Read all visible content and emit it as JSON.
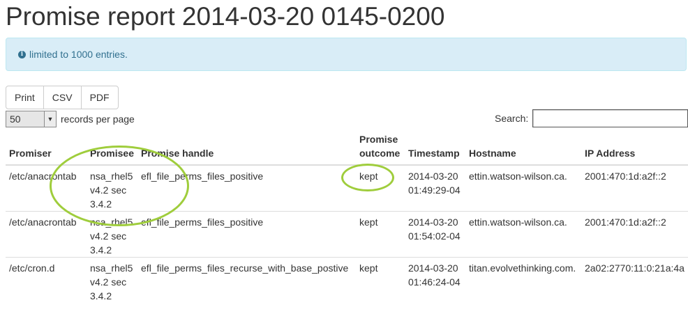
{
  "page": {
    "title": "Promise report 2014-03-20 0145-0200"
  },
  "alert": {
    "icon": "info-icon",
    "text": "limited to 1000 entries."
  },
  "export_buttons": {
    "print": "Print",
    "csv": "CSV",
    "pdf": "PDF"
  },
  "length_control": {
    "value": "50",
    "label": "records per page"
  },
  "search": {
    "label": "Search:",
    "value": ""
  },
  "table": {
    "columns": [
      "Promiser",
      "Promisee",
      "Promise handle",
      "Promise outcome",
      "Timestamp",
      "Hostname",
      "IP Address"
    ],
    "rows": [
      {
        "promiser": "/etc/anacrontab",
        "promisee": "nsa_rhel5 v4.2 sec 3.4.2",
        "handle": "efl_file_perms_files_positive",
        "outcome": "kept",
        "timestamp": "2014-03-20 01:49:29-04",
        "hostname": "ettin.watson-wilson.ca.",
        "ip": "2001:470:1d:a2f::2"
      },
      {
        "promiser": "/etc/anacrontab",
        "promisee": "nsa_rhel5 v4.2 sec 3.4.2",
        "handle": "efl_file_perms_files_positive",
        "outcome": "kept",
        "timestamp": "2014-03-20 01:54:02-04",
        "hostname": "ettin.watson-wilson.ca.",
        "ip": "2001:470:1d:a2f::2"
      },
      {
        "promiser": "/etc/cron.d",
        "promisee": "nsa_rhel5 v4.2 sec 3.4.2",
        "handle": "efl_file_perms_files_recurse_with_base_postive",
        "outcome": "kept",
        "timestamp": "2014-03-20 01:46:24-04",
        "hostname": "titan.evolvethinking.com.",
        "ip": "2a02:2770:11:0:21a:4a"
      }
    ]
  },
  "annotation_color": "#9fcd3c"
}
